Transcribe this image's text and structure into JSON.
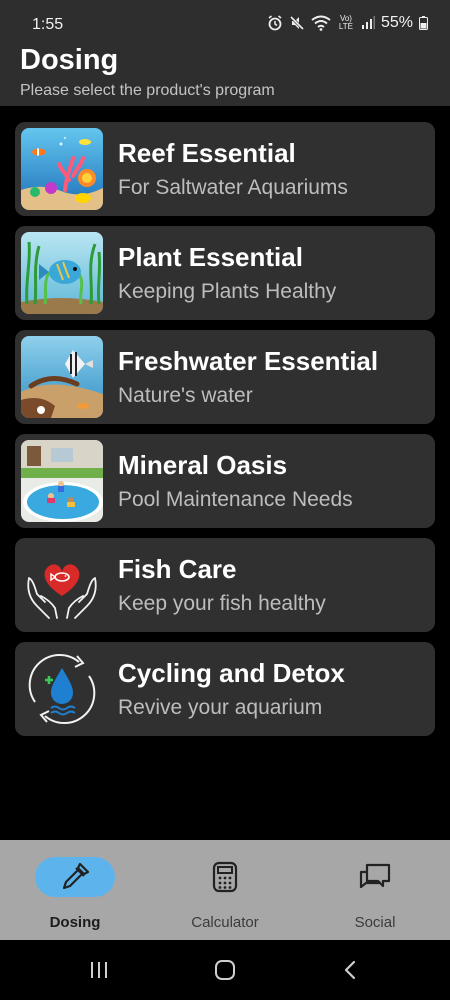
{
  "status_bar": {
    "time": "1:55",
    "lte_label": "Vo) LTE",
    "battery_percent": "55%",
    "icons": [
      "alarm-icon",
      "mute-icon",
      "wifi-icon",
      "lte-icon",
      "signal-icon",
      "battery-icon"
    ]
  },
  "header": {
    "title": "Dosing",
    "subtitle": "Please select the product's program"
  },
  "programs": [
    {
      "title": "Reef Essential",
      "subtitle": "For Saltwater Aquariums",
      "icon": "reef-thumbnail"
    },
    {
      "title": "Plant Essential",
      "subtitle": "Keeping Plants Healthy",
      "icon": "plant-thumbnail"
    },
    {
      "title": "Freshwater Essential",
      "subtitle": "Nature's water",
      "icon": "freshwater-thumbnail"
    },
    {
      "title": "Mineral Oasis",
      "subtitle": "Pool Maintenance Needs",
      "icon": "pool-thumbnail"
    },
    {
      "title": "Fish Care",
      "subtitle": "Keep your fish healthy",
      "icon": "heart-fish-hands-icon"
    },
    {
      "title": "Cycling and Detox",
      "subtitle": "Revive your aquarium",
      "icon": "water-drop-cycle-icon"
    }
  ],
  "bottom_nav": {
    "active": "Dosing",
    "items": [
      {
        "label": "Dosing",
        "icon": "dropper-icon"
      },
      {
        "label": "Calculator",
        "icon": "calculator-icon"
      },
      {
        "label": "Social",
        "icon": "chat-bubbles-icon"
      }
    ]
  },
  "system_nav": {
    "icons": [
      "recents-icon",
      "home-icon",
      "back-icon"
    ]
  },
  "colors": {
    "background": "#000000",
    "header": "#2e2e2e",
    "card": "#303030",
    "bottom_nav": "#a7a7a7",
    "active_pill": "#5db4ec",
    "heart": "#d92a2a",
    "drop": "#1f7fd1"
  }
}
